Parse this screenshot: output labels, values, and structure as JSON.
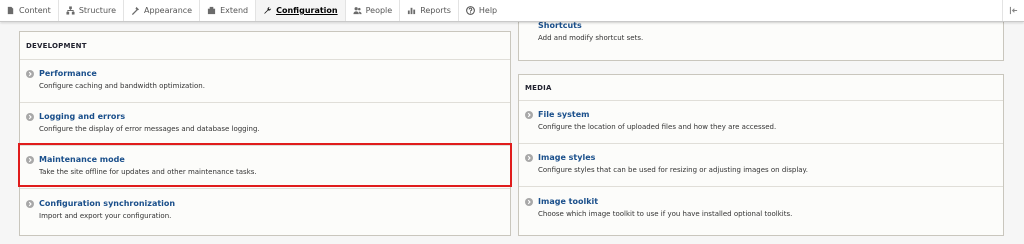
{
  "toolbar": {
    "items": [
      {
        "label": "Content",
        "icon": "content-icon"
      },
      {
        "label": "Structure",
        "icon": "structure-icon"
      },
      {
        "label": "Appearance",
        "icon": "appearance-icon"
      },
      {
        "label": "Extend",
        "icon": "extend-icon"
      },
      {
        "label": "Configuration",
        "icon": "wrench-icon",
        "active": true
      },
      {
        "label": "People",
        "icon": "people-icon"
      },
      {
        "label": "Reports",
        "icon": "reports-icon"
      },
      {
        "label": "Help",
        "icon": "help-icon"
      }
    ],
    "collapse_icon": "collapse-sidebar-icon"
  },
  "development": {
    "title": "DEVELOPMENT",
    "items": [
      {
        "label": "Performance",
        "description": "Configure caching and bandwidth optimization."
      },
      {
        "label": "Logging and errors",
        "description": "Configure the display of error messages and database logging."
      },
      {
        "label": "Maintenance mode",
        "description": "Take the site offline for updates and other maintenance tasks."
      },
      {
        "label": "Configuration synchronization",
        "description": "Import and export your configuration."
      }
    ]
  },
  "shortcuts": {
    "label": "Shortcuts",
    "description": "Add and modify shortcut sets."
  },
  "media": {
    "title": "MEDIA",
    "items": [
      {
        "label": "File system",
        "description": "Configure the location of uploaded files and how they are accessed."
      },
      {
        "label": "Image styles",
        "description": "Configure styles that can be used for resizing or adjusting images on display."
      },
      {
        "label": "Image toolkit",
        "description": "Choose which image toolkit to use if you have installed optional toolkits."
      }
    ]
  },
  "colors": {
    "link": "#1a4f8b",
    "highlight": "#e01c1c",
    "panel_border": "#c9c6bd"
  }
}
